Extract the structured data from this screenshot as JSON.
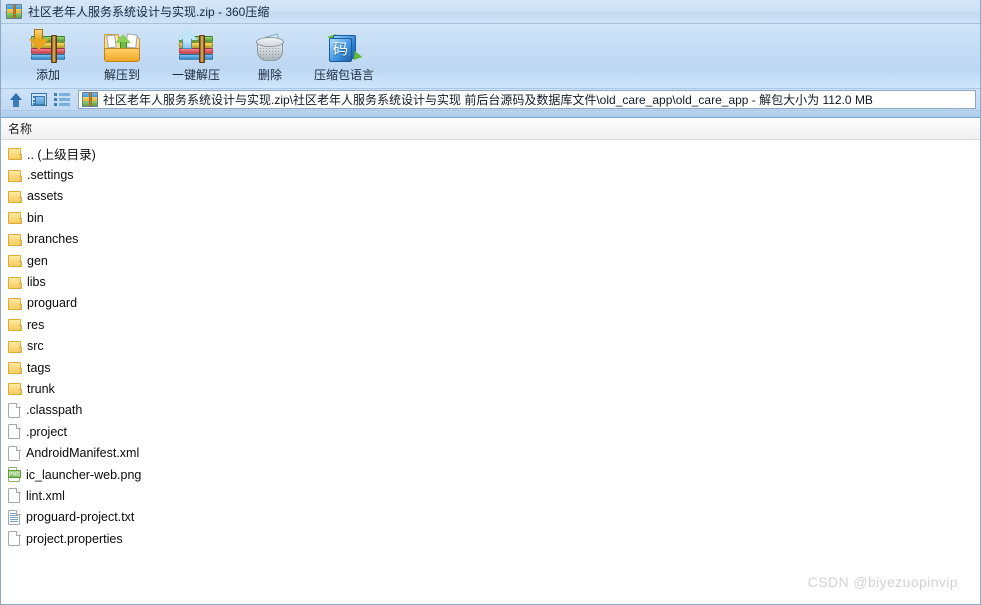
{
  "window": {
    "title": "社区老年人服务系统设计与实现.zip - 360压缩",
    "icon": "archive-icon"
  },
  "toolbar": {
    "buttons": [
      {
        "label": "添加",
        "icon": "archive-add-icon"
      },
      {
        "label": "解压到",
        "icon": "folder-extract-icon"
      },
      {
        "label": "一键解压",
        "icon": "archive-extract-icon"
      },
      {
        "label": "删除",
        "icon": "trash-icon"
      },
      {
        "label": "压缩包语言",
        "icon": "language-icon"
      }
    ]
  },
  "addressbar": {
    "up_icon": "up-arrow-icon",
    "panel_icon": "preview-panel-icon",
    "list_icon": "list-view-icon",
    "path_icon": "archive-icon",
    "path": "社区老年人服务系统设计与实现.zip\\社区老年人服务系统设计与实现 前后台源码及数据库文件\\old_care_app\\old_care_app - 解包大小为 112.0 MB"
  },
  "columns": {
    "name": "名称"
  },
  "files": [
    {
      "name": ".. (上级目录)",
      "type": "folder"
    },
    {
      "name": ".settings",
      "type": "folder"
    },
    {
      "name": "assets",
      "type": "folder"
    },
    {
      "name": "bin",
      "type": "folder"
    },
    {
      "name": "branches",
      "type": "folder"
    },
    {
      "name": "gen",
      "type": "folder"
    },
    {
      "name": "libs",
      "type": "folder"
    },
    {
      "name": "proguard",
      "type": "folder"
    },
    {
      "name": "res",
      "type": "folder"
    },
    {
      "name": "src",
      "type": "folder"
    },
    {
      "name": "tags",
      "type": "folder"
    },
    {
      "name": "trunk",
      "type": "folder"
    },
    {
      "name": ".classpath",
      "type": "file"
    },
    {
      "name": ".project",
      "type": "file"
    },
    {
      "name": "AndroidManifest.xml",
      "type": "file"
    },
    {
      "name": "ic_launcher-web.png",
      "type": "png"
    },
    {
      "name": "lint.xml",
      "type": "file"
    },
    {
      "name": "proguard-project.txt",
      "type": "text"
    },
    {
      "name": "project.properties",
      "type": "file"
    }
  ],
  "watermark": {
    "text": "CSDN @biyezuopinvip"
  },
  "theme": {
    "title_gradient_top": "#d5e6f7",
    "toolbar_gradient_top": "#cfe4f8",
    "accent_blue": "#2f6fae",
    "folder_yellow": "#fbd878",
    "watermark_gray": "#d2d2d2"
  }
}
